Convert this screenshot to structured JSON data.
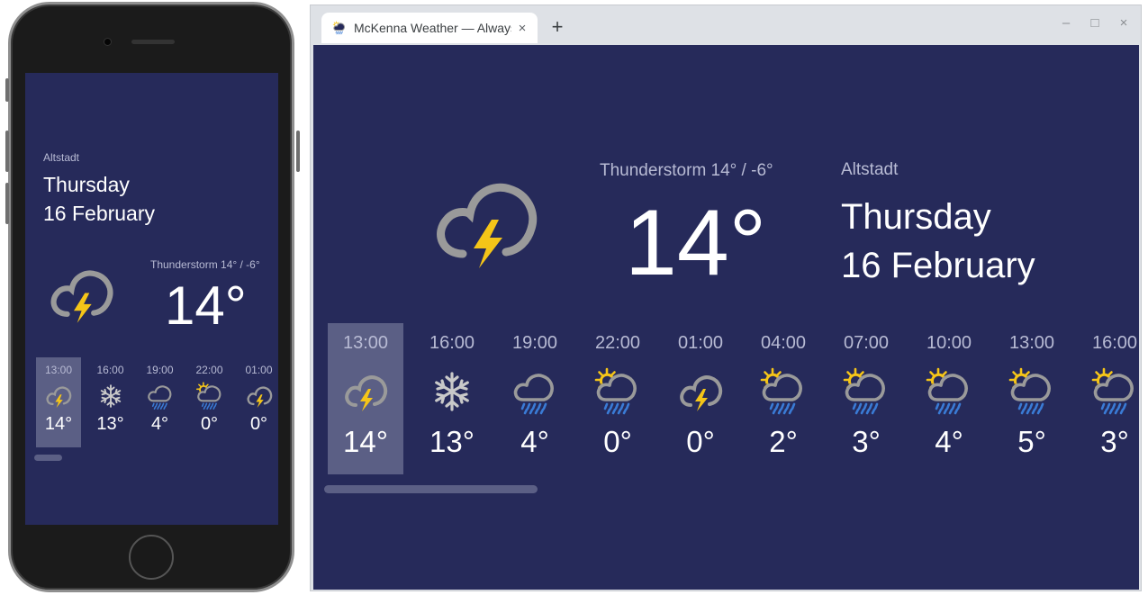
{
  "phone": {
    "location": "Altstadt",
    "day": "Thursday",
    "date": "16 February",
    "condition": "Thunderstorm  14° / -6°",
    "temperature": "14°",
    "hours": [
      {
        "time": "13:00",
        "temp": "14°",
        "icon": "thunderstorm-icon"
      },
      {
        "time": "16:00",
        "temp": "13°",
        "icon": "snow-icon"
      },
      {
        "time": "19:00",
        "temp": "4°",
        "icon": "rain-icon"
      },
      {
        "time": "22:00",
        "temp": "0°",
        "icon": "sun-rain-icon"
      },
      {
        "time": "01:00",
        "temp": "0°",
        "icon": "thunderstorm-icon"
      }
    ]
  },
  "browser": {
    "tab_title": "McKenna Weather — Always",
    "tab_close": "×",
    "new_tab": "+",
    "minimize": "–",
    "maximize": "□",
    "close": "×"
  },
  "weather": {
    "condition": "Thunderstorm  14° / -6°",
    "temperature": "14°",
    "location": "Altstadt",
    "day": "Thursday",
    "date": "16 February",
    "hours": [
      {
        "time": "13:00",
        "temp": "14°",
        "icon": "thunderstorm-icon"
      },
      {
        "time": "16:00",
        "temp": "13°",
        "icon": "snow-icon"
      },
      {
        "time": "19:00",
        "temp": "4°",
        "icon": "rain-icon"
      },
      {
        "time": "22:00",
        "temp": "0°",
        "icon": "sun-rain-icon"
      },
      {
        "time": "01:00",
        "temp": "0°",
        "icon": "thunderstorm-icon"
      },
      {
        "time": "04:00",
        "temp": "2°",
        "icon": "sun-rain-icon"
      },
      {
        "time": "07:00",
        "temp": "3°",
        "icon": "sun-rain-icon"
      },
      {
        "time": "10:00",
        "temp": "4°",
        "icon": "sun-rain-icon"
      },
      {
        "time": "13:00",
        "temp": "5°",
        "icon": "sun-rain-icon"
      },
      {
        "time": "16:00",
        "temp": "3°",
        "icon": "sun-rain-icon"
      }
    ]
  },
  "colors": {
    "background": "#262a5a",
    "selected": "#5b5f85",
    "cloud": "#9a9a9a",
    "bolt": "#f5c518",
    "rain": "#3a7bd5"
  }
}
